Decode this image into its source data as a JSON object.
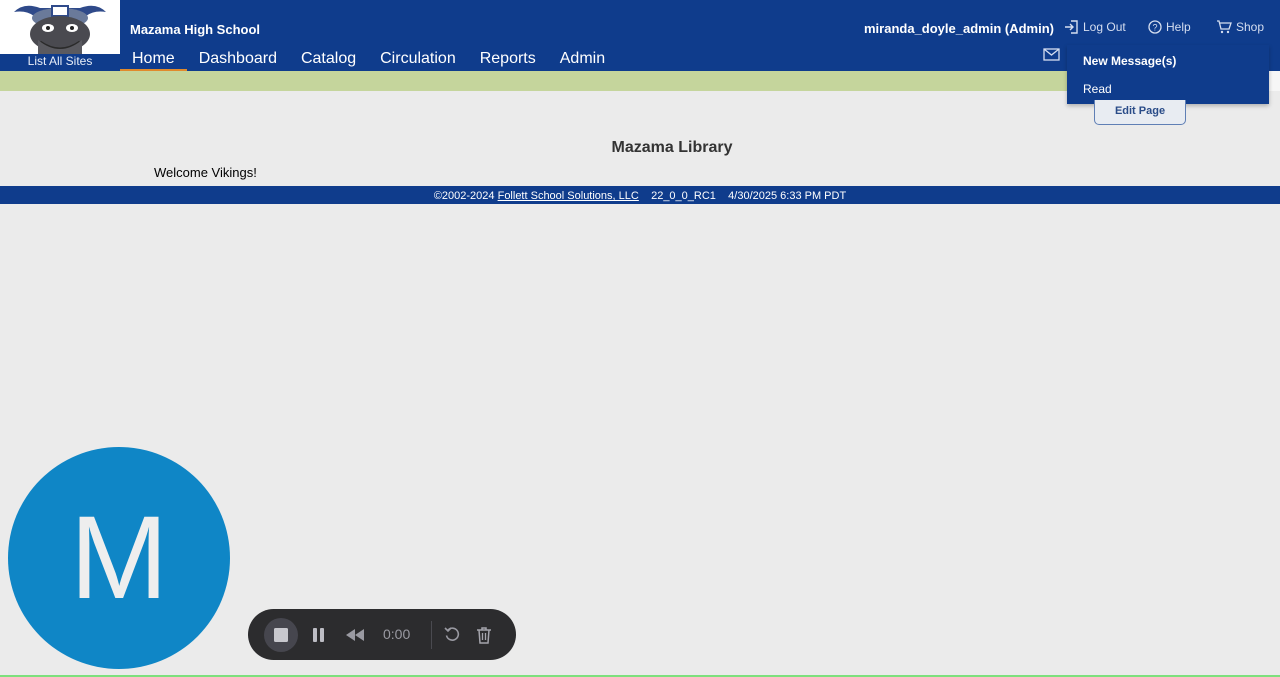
{
  "header": {
    "school_name": "Mazama High School",
    "list_all_sites": "List All Sites",
    "user": "miranda_doyle_admin (Admin)",
    "logout": "Log Out",
    "help": "Help",
    "shop": "Shop",
    "nav": [
      {
        "label": "Home",
        "active": true
      },
      {
        "label": "Dashboard"
      },
      {
        "label": "Catalog"
      },
      {
        "label": "Circulation"
      },
      {
        "label": "Reports"
      },
      {
        "label": "Admin"
      }
    ]
  },
  "messages_menu": {
    "new_messages": "New Message(s)",
    "read": "Read"
  },
  "main": {
    "edit_page": "Edit Page",
    "title": "Mazama Library",
    "welcome": "Welcome Vikings!"
  },
  "footer": {
    "copyright": "©2002-2024",
    "company_link": "Follett School Solutions, LLC",
    "version": "22_0_0_RC1",
    "datetime": "4/30/2025 6:33 PM PDT"
  },
  "avatar": {
    "initial": "M",
    "color": "#0f86c6"
  },
  "recorder": {
    "time": "0:00"
  },
  "colors": {
    "header_blue": "#0f3c8c",
    "accent_orange": "#e08a2c",
    "band_green": "#c5d59c"
  }
}
